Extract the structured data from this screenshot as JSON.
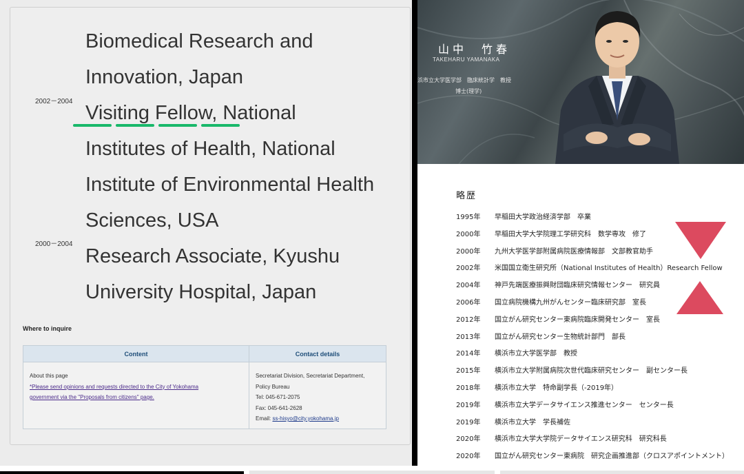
{
  "left": {
    "years": [
      "2002－2004",
      "2000－2004"
    ],
    "career_lines": [
      "Biomedical Research and",
      "Innovation, Japan",
      "Visiting Fellow, National",
      "Institutes of Health, National",
      "Institute of Environmental Health",
      "Sciences, USA",
      "Research Associate, Kyushu",
      "University Hospital, Japan"
    ],
    "inquire_title": "Where to inquire",
    "table": {
      "headers": [
        "Content",
        "Contact details"
      ],
      "content_label": "About this page",
      "content_link_line1": "*Please send opinions and requests directed to the City of Yokohama",
      "content_link_line2": "government via the \"Proposals from citizens\" page.",
      "contact_line1": "Secretariat Division, Secretariat Department,",
      "contact_line2": "Policy Bureau",
      "contact_tel": "Tel: 045-671-2075",
      "contact_fax": "Fax: 045-641-2628",
      "contact_email_label": "Email:",
      "contact_email": "ss-hisyo@city.yokohama.jp"
    }
  },
  "right": {
    "name_jp": "山中　竹春",
    "name_roman": "TAKEHARU  YAMANAKA",
    "affiliation": "浜市立大学医学部　臨床統計学　教授",
    "degree": "博士(理学)",
    "history_title": "略歴",
    "history": [
      {
        "year": "1995年",
        "text": "早稲田大学政治経済学部　卒業"
      },
      {
        "year": "2000年",
        "text": "早稲田大学大学院理工学研究科　数学専攻　修了"
      },
      {
        "year": "2000年",
        "text": "九州大学医学部附属病院医療情報部　文部教官助手"
      },
      {
        "year": "2002年",
        "text": "米国国立衛生研究所（National Institutes of Health）Research Fellow"
      },
      {
        "year": "2004年",
        "text": "神戸先端医療振興財団臨床研究情報センター　研究員"
      },
      {
        "year": "2006年",
        "text": "国立病院機構九州がんセンター臨床研究部　室長"
      },
      {
        "year": "2012年",
        "text": "国立がん研究センター東病院臨床開発センター　室長"
      },
      {
        "year": "2013年",
        "text": "国立がん研究センター生物統計部門　部長"
      },
      {
        "year": "2014年",
        "text": "横浜市立大学医学部　教授"
      },
      {
        "year": "2015年",
        "text": "横浜市立大学附属病院次世代臨床研究センター　副センター長"
      },
      {
        "year": "2018年",
        "text": "横浜市立大学　特命副学長（-2019年）"
      },
      {
        "year": "2019年",
        "text": "横浜市立大学データサイエンス推進センター　センター長"
      },
      {
        "year": "2019年",
        "text": "横浜市立大学　学長補佐"
      },
      {
        "year": "2020年",
        "text": "横浜市立大学大学院データサイエンス研究科　研究科長"
      },
      {
        "year": "2020年",
        "text": "国立がん研究センター東病院　研究企画推進部（クロスアポイントメント）"
      }
    ]
  },
  "colors": {
    "underline": "#19b86a",
    "triangle": "#dc4a5f",
    "table_header_bg": "#dbe5ee",
    "table_header_text": "#1f4e79"
  }
}
